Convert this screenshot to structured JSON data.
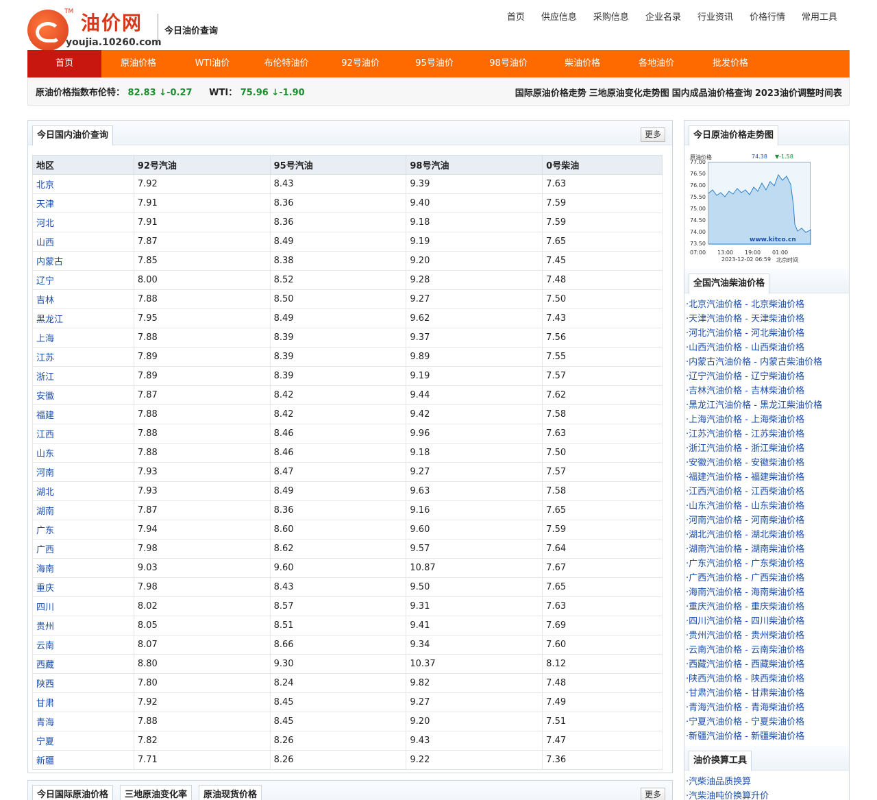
{
  "header": {
    "logo_cn": "油价网",
    "logo_tm": "TM",
    "logo_domain": "youjia.10260.com",
    "subtitle": "今日油价查询",
    "topnav": [
      "首页",
      "供应信息",
      "采购信息",
      "企业名录",
      "行业资讯",
      "价格行情",
      "常用工具"
    ]
  },
  "mainnav": [
    "首页",
    "原油价格",
    "WTI油价",
    "布伦特油价",
    "92号油价",
    "95号油价",
    "98号油价",
    "柴油价格",
    "各地油价",
    "批发价格"
  ],
  "ticker": {
    "brent_label": "原油价格指数布伦特：",
    "brent_value": "82.83",
    "brent_change": "↓-0.27",
    "wti_label": "WTI：",
    "wti_value": "75.96",
    "wti_change": "↓-1.90",
    "links": [
      "国际原油价格走势",
      "三地原油变化走势图",
      "国内成品油价格查询",
      "2023油价调整时间表"
    ]
  },
  "panel": {
    "title": "今日国内油价查询",
    "more": "更多",
    "columns": [
      "地区",
      "92号汽油",
      "95号汽油",
      "98号汽油",
      "0号柴油"
    ],
    "rows": [
      [
        "北京",
        "7.92",
        "8.43",
        "9.39",
        "7.63"
      ],
      [
        "天津",
        "7.91",
        "8.36",
        "9.40",
        "7.59"
      ],
      [
        "河北",
        "7.91",
        "8.36",
        "9.18",
        "7.59"
      ],
      [
        "山西",
        "7.87",
        "8.49",
        "9.19",
        "7.65"
      ],
      [
        "内蒙古",
        "7.85",
        "8.38",
        "9.20",
        "7.45"
      ],
      [
        "辽宁",
        "8.00",
        "8.52",
        "9.28",
        "7.48"
      ],
      [
        "吉林",
        "7.88",
        "8.50",
        "9.27",
        "7.50"
      ],
      [
        "黑龙江",
        "7.95",
        "8.49",
        "9.62",
        "7.43"
      ],
      [
        "上海",
        "7.88",
        "8.39",
        "9.37",
        "7.56"
      ],
      [
        "江苏",
        "7.89",
        "8.39",
        "9.89",
        "7.55"
      ],
      [
        "浙江",
        "7.89",
        "8.39",
        "9.19",
        "7.57"
      ],
      [
        "安徽",
        "7.87",
        "8.42",
        "9.44",
        "7.62"
      ],
      [
        "福建",
        "7.88",
        "8.42",
        "9.42",
        "7.58"
      ],
      [
        "江西",
        "7.88",
        "8.46",
        "9.96",
        "7.63"
      ],
      [
        "山东",
        "7.88",
        "8.46",
        "9.18",
        "7.50"
      ],
      [
        "河南",
        "7.93",
        "8.47",
        "9.27",
        "7.57"
      ],
      [
        "湖北",
        "7.93",
        "8.49",
        "9.63",
        "7.58"
      ],
      [
        "湖南",
        "7.87",
        "8.36",
        "9.16",
        "7.65"
      ],
      [
        "广东",
        "7.94",
        "8.60",
        "9.60",
        "7.59"
      ],
      [
        "广西",
        "7.98",
        "8.62",
        "9.57",
        "7.64"
      ],
      [
        "海南",
        "9.03",
        "9.60",
        "10.87",
        "7.67"
      ],
      [
        "重庆",
        "7.98",
        "8.43",
        "9.50",
        "7.65"
      ],
      [
        "四川",
        "8.02",
        "8.57",
        "9.31",
        "7.63"
      ],
      [
        "贵州",
        "8.05",
        "8.51",
        "9.41",
        "7.69"
      ],
      [
        "云南",
        "8.07",
        "8.66",
        "9.34",
        "7.60"
      ],
      [
        "西藏",
        "8.80",
        "9.30",
        "10.37",
        "8.12"
      ],
      [
        "陕西",
        "7.80",
        "8.24",
        "9.82",
        "7.48"
      ],
      [
        "甘肃",
        "7.92",
        "8.45",
        "9.27",
        "7.49"
      ],
      [
        "青海",
        "7.88",
        "8.45",
        "9.20",
        "7.51"
      ],
      [
        "宁夏",
        "7.82",
        "8.26",
        "9.43",
        "7.47"
      ],
      [
        "新疆",
        "7.71",
        "8.26",
        "9.22",
        "7.36"
      ]
    ]
  },
  "bottom_tabs": [
    "今日国际原油价格",
    "三地原油变化率",
    "原油现货价格"
  ],
  "bottom_more": "更多",
  "sidebar": {
    "chart_title": "今日原油价格走势图",
    "chart_name": "原油价格",
    "chart_price": "74.38",
    "chart_change": "-1.58",
    "chart_yticks": [
      "77.00",
      "76.50",
      "76.00",
      "75.50",
      "75.00",
      "74.50",
      "74.00",
      "73.50"
    ],
    "chart_xticks": [
      "07:00",
      "13:00",
      "19:00",
      "01:00"
    ],
    "chart_watermark": "www.kitco.cn",
    "chart_date": "2023-12-02 06:59",
    "chart_tz": "北京时间",
    "links_title": "全国汽油柴油价格",
    "links": [
      "北京汽油价格 - 北京柴油价格",
      "天津汽油价格 - 天津柴油价格",
      "河北汽油价格 - 河北柴油价格",
      "山西汽油价格 - 山西柴油价格",
      "内蒙古汽油价格 - 内蒙古柴油价格",
      "辽宁汽油价格 - 辽宁柴油价格",
      "吉林汽油价格 - 吉林柴油价格",
      "黑龙江汽油价格 - 黑龙江柴油价格",
      "上海汽油价格 - 上海柴油价格",
      "江苏汽油价格 - 江苏柴油价格",
      "浙江汽油价格 - 浙江柴油价格",
      "安徽汽油价格 - 安徽柴油价格",
      "福建汽油价格 - 福建柴油价格",
      "江西汽油价格 - 江西柴油价格",
      "山东汽油价格 - 山东柴油价格",
      "河南汽油价格 - 河南柴油价格",
      "湖北汽油价格 - 湖北柴油价格",
      "湖南汽油价格 - 湖南柴油价格",
      "广东汽油价格 - 广东柴油价格",
      "广西汽油价格 - 广西柴油价格",
      "海南汽油价格 - 海南柴油价格",
      "重庆汽油价格 - 重庆柴油价格",
      "四川汽油价格 - 四川柴油价格",
      "贵州汽油价格 - 贵州柴油价格",
      "云南汽油价格 - 云南柴油价格",
      "西藏汽油价格 - 西藏柴油价格",
      "陕西汽油价格 - 陕西柴油价格",
      "甘肃汽油价格 - 甘肃柴油价格",
      "青海汽油价格 - 青海柴油价格",
      "宁夏汽油价格 - 宁夏柴油价格",
      "新疆汽油价格 - 新疆柴油价格"
    ],
    "tools_title": "油价换算工具",
    "tools": [
      "汽柴油品质换算",
      "汽柴油吨价换算升价"
    ]
  },
  "colors": {
    "nav_orange": "#ff6a00",
    "nav_active": "#c8170f",
    "link_blue": "#1a4dab",
    "price_green": "#1a8f2e"
  }
}
